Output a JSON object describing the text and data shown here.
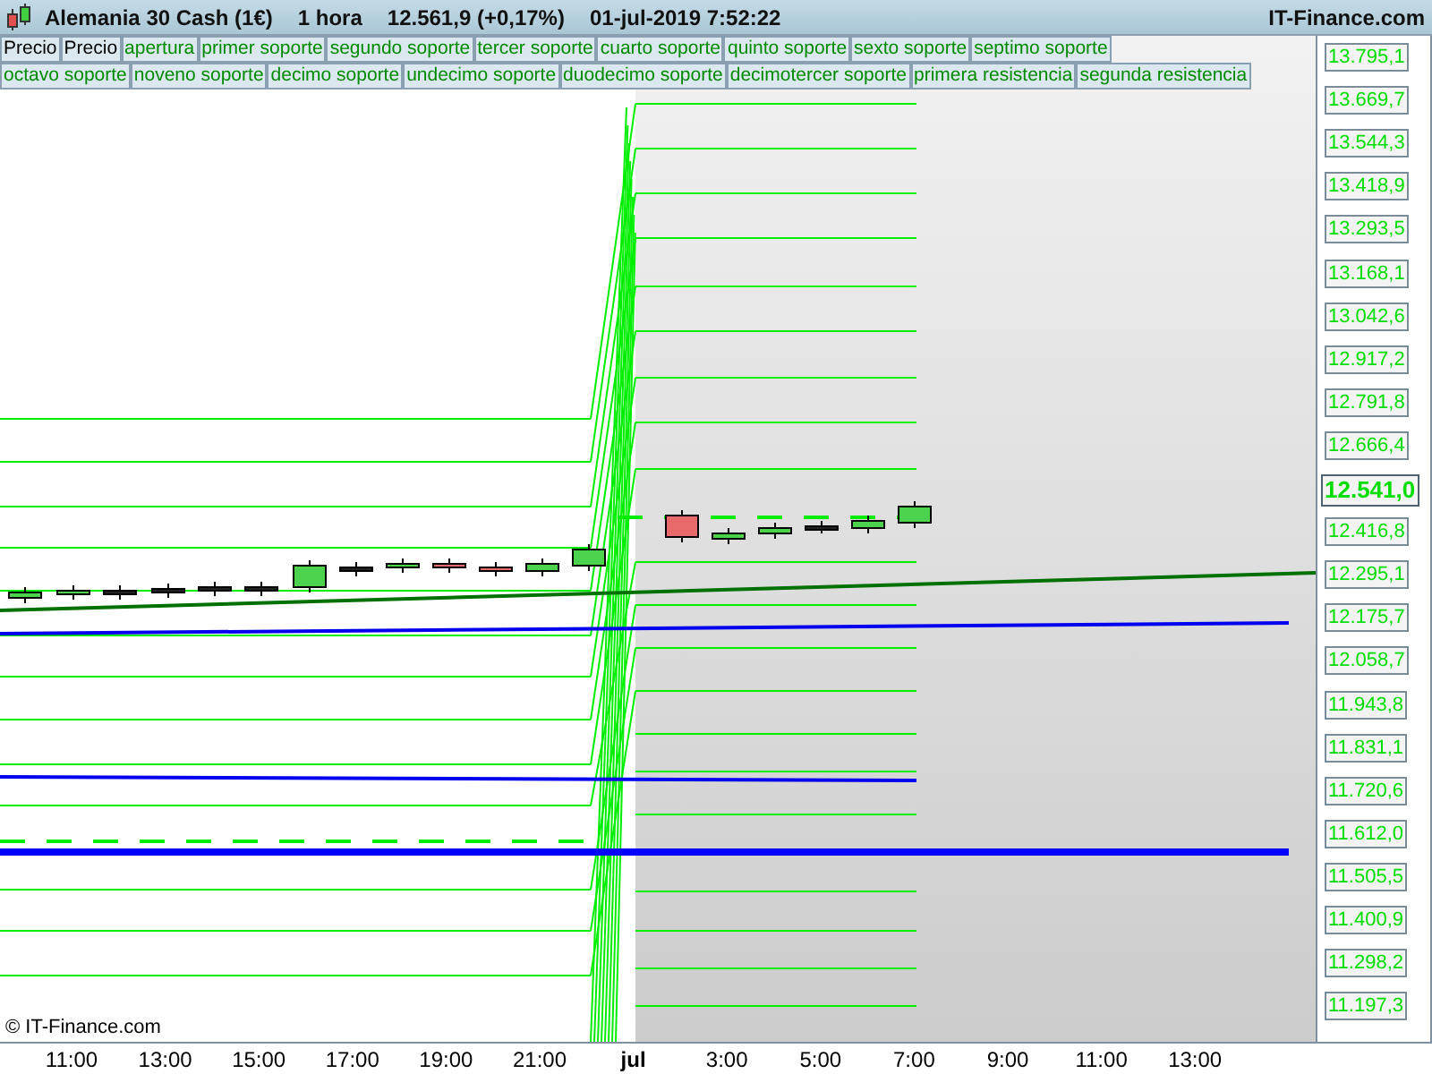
{
  "header": {
    "title": "Alemania 30 Cash (1€)",
    "interval": "1 hora",
    "price": "12.561,9 (+0,17%)",
    "datetime": "01-jul-2019 7:52:22",
    "brand": "IT-Finance.com"
  },
  "legend": [
    [
      {
        "label": "Precio",
        "color": "#000000"
      },
      {
        "label": "Precio",
        "color": "#000000"
      },
      {
        "label": "apertura",
        "color": "#008a00"
      },
      {
        "label": "primer soporte",
        "color": "#008a00"
      },
      {
        "label": "segundo soporte",
        "color": "#008a00"
      },
      {
        "label": "tercer soporte",
        "color": "#008a00"
      },
      {
        "label": "cuarto soporte",
        "color": "#008a00"
      },
      {
        "label": "quinto soporte",
        "color": "#008a00"
      },
      {
        "label": "sexto soporte",
        "color": "#008a00"
      },
      {
        "label": "septimo soporte",
        "color": "#008a00"
      }
    ],
    [
      {
        "label": "octavo soporte",
        "color": "#008a00"
      },
      {
        "label": "noveno soporte",
        "color": "#008a00"
      },
      {
        "label": "decimo soporte",
        "color": "#008a00"
      },
      {
        "label": "undecimo soporte",
        "color": "#008a00"
      },
      {
        "label": "duodecimo soporte",
        "color": "#008a00"
      },
      {
        "label": "decimotercer soporte",
        "color": "#008a00"
      },
      {
        "label": "primera resistencia",
        "color": "#008a00"
      },
      {
        "label": "segunda resistencia",
        "color": "#008a00"
      }
    ]
  ],
  "price_labels": [
    {
      "text": "13.795,1",
      "kind": "level"
    },
    {
      "text": "13.669,7",
      "kind": "level"
    },
    {
      "text": "13.544,3",
      "kind": "level"
    },
    {
      "text": "13.418,9",
      "kind": "level"
    },
    {
      "text": "13.293,5",
      "kind": "level"
    },
    {
      "text": "13.168,1",
      "kind": "level"
    },
    {
      "text": "13.042,6",
      "kind": "level"
    },
    {
      "text": "12.917,2",
      "kind": "level"
    },
    {
      "text": "12.791,8",
      "kind": "level"
    },
    {
      "text": "12.666,4",
      "kind": "level"
    },
    {
      "text": "12.541,0",
      "kind": "current"
    },
    {
      "text": "12.416,8",
      "kind": "level"
    },
    {
      "text": "12.295,1",
      "kind": "level"
    },
    {
      "text": "12.175,7",
      "kind": "level"
    },
    {
      "text": "12.058,7",
      "kind": "level"
    },
    {
      "text": "11.943,8",
      "kind": "level"
    },
    {
      "text": "11.831,1",
      "kind": "level"
    },
    {
      "text": "11.720,6",
      "kind": "level"
    },
    {
      "text": "11.612,0",
      "kind": "level"
    },
    {
      "text": "11.505,5",
      "kind": "level"
    },
    {
      "text": "11.400,9",
      "kind": "level"
    },
    {
      "text": "11.298,2",
      "kind": "level"
    },
    {
      "text": "11.197,3",
      "kind": "level"
    }
  ],
  "time_labels": [
    {
      "text": "11:00",
      "bold": false
    },
    {
      "text": "13:00",
      "bold": false
    },
    {
      "text": "15:00",
      "bold": false
    },
    {
      "text": "17:00",
      "bold": false
    },
    {
      "text": "19:00",
      "bold": false
    },
    {
      "text": "21:00",
      "bold": false
    },
    {
      "text": "jul",
      "bold": true
    },
    {
      "text": "3:00",
      "bold": false
    },
    {
      "text": "5:00",
      "bold": false
    },
    {
      "text": "7:00",
      "bold": false
    },
    {
      "text": "9:00",
      "bold": false
    },
    {
      "text": "11:00",
      "bold": false
    },
    {
      "text": "13:00",
      "bold": false
    }
  ],
  "credit": "© IT-Finance.com"
}
